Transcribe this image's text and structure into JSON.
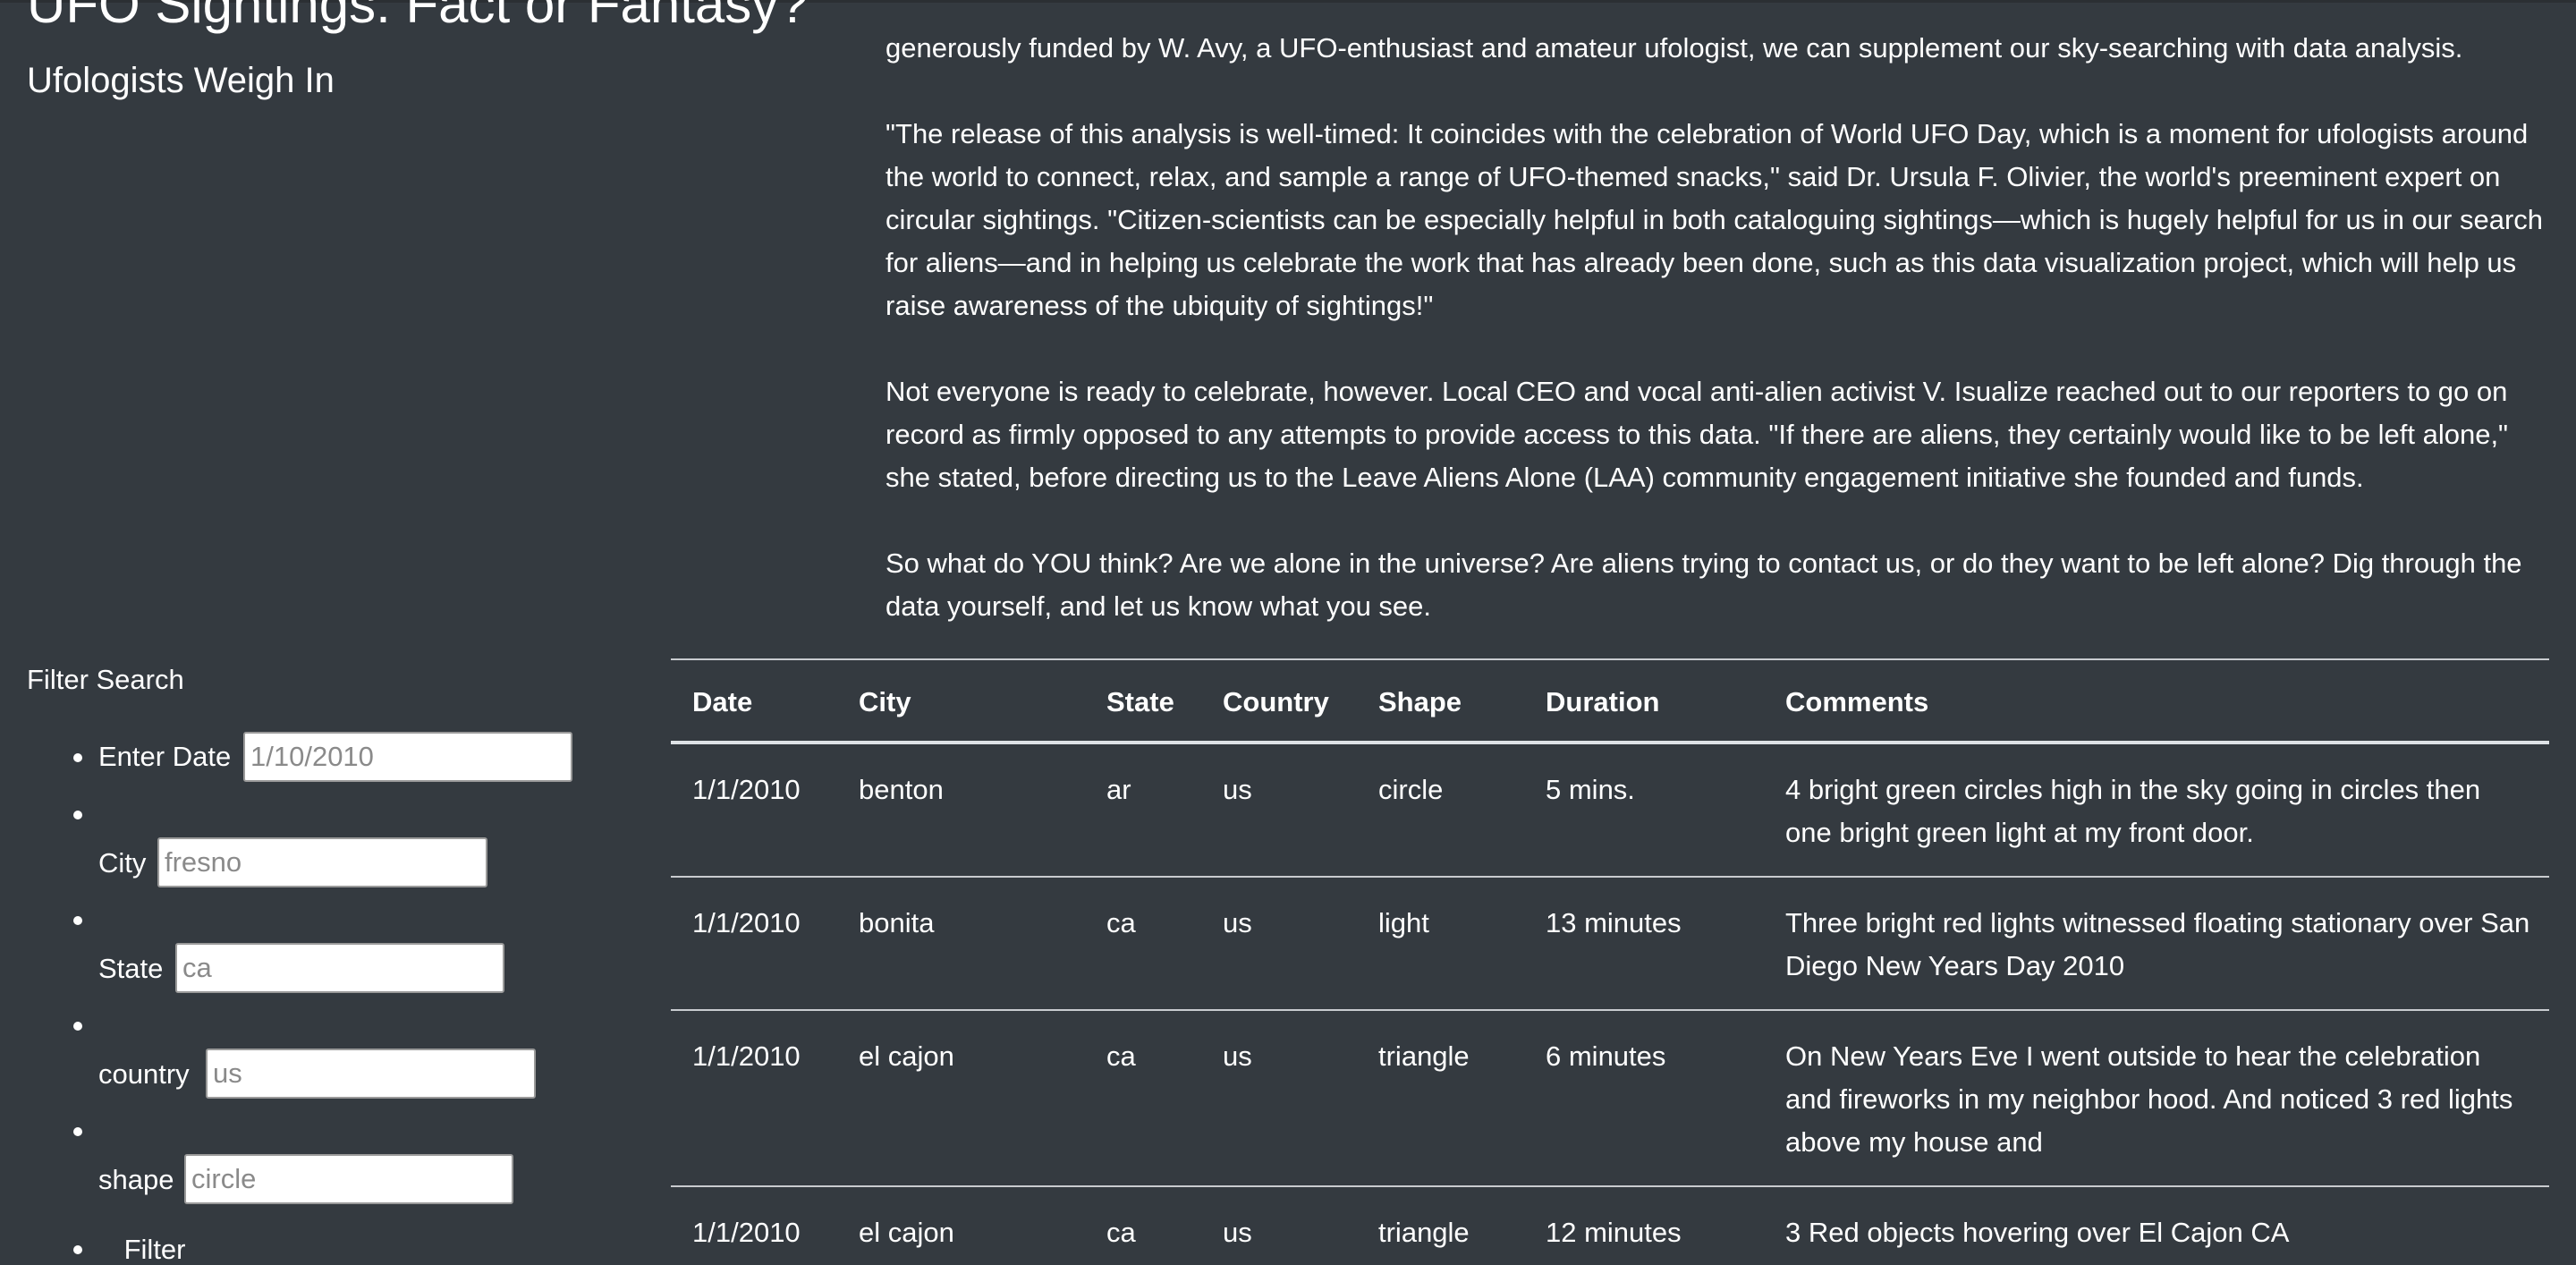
{
  "header": {
    "title": "UFO Sightings: Fact or Fantasy?",
    "subtitle": "Ufologists Weigh In"
  },
  "article": {
    "paragraphs": [
      "generously funded by W. Avy, a UFO-enthusiast and amateur ufologist, we can supplement our sky-searching with data analysis.",
      "\"The release of this analysis is well-timed: It coincides with the celebration of World UFO Day, which is a moment for ufologists around the world to connect, relax, and sample a range of UFO-themed snacks,\" said Dr. Ursula F. Olivier, the world's preeminent expert on circular sightings. \"Citizen-scientists can be especially helpful in both cataloguing sightings—which is hugely helpful for us in our search for aliens—and in helping us celebrate the work that has already been done, such as this data visualization project, which will help us raise awareness of the ubiquity of sightings!\"",
      "Not everyone is ready to celebrate, however. Local CEO and vocal anti-alien activist V. Isualize reached out to our reporters to go on record as firmly opposed to any attempts to provide access to this data. \"If there are aliens, they certainly would like to be left alone,\" she stated, before directing us to the Leave Aliens Alone (LAA) community engagement initiative she founded and funds.",
      "So what do YOU think? Are we alone in the universe? Are aliens trying to contact us, or do they want to be left alone? Dig through the data yourself, and let us know what you see."
    ]
  },
  "filters": {
    "heading": "Filter Search",
    "date": {
      "label": "Enter Date",
      "placeholder": "1/10/2010"
    },
    "city": {
      "label": "City",
      "placeholder": "fresno"
    },
    "state": {
      "label": "State",
      "placeholder": "ca"
    },
    "country": {
      "label": "country",
      "placeholder": "us"
    },
    "shape": {
      "label": "shape",
      "placeholder": "circle"
    },
    "button_label": "Filter Table"
  },
  "table": {
    "columns": [
      "Date",
      "City",
      "State",
      "Country",
      "Shape",
      "Duration",
      "Comments"
    ],
    "rows": [
      [
        "1/1/2010",
        "benton",
        "ar",
        "us",
        "circle",
        "5 mins.",
        "4 bright green circles high in the sky going in circles then one bright green light at my front door."
      ],
      [
        "1/1/2010",
        "bonita",
        "ca",
        "us",
        "light",
        "13 minutes",
        "Three bright red lights witnessed floating stationary over San Diego New Years Day 2010"
      ],
      [
        "1/1/2010",
        "el cajon",
        "ca",
        "us",
        "triangle",
        "6 minutes",
        "On New Years Eve I went outside to hear the celebration and fireworks in my neighbor hood. And noticed 3 red lights above my house and"
      ],
      [
        "1/1/2010",
        "el cajon",
        "ca",
        "us",
        "triangle",
        "12 minutes",
        "3 Red objects hovering over El Cajon CA"
      ]
    ]
  }
}
